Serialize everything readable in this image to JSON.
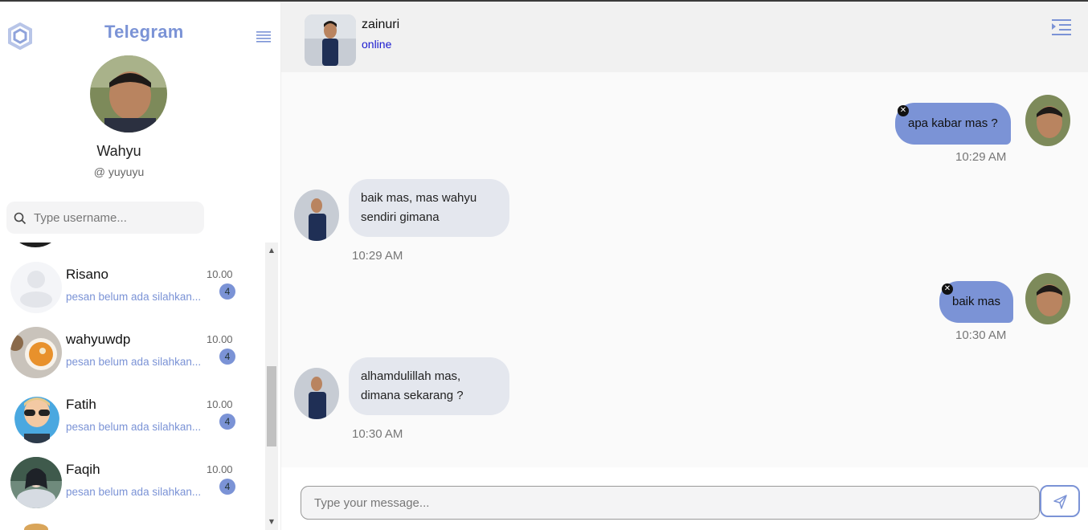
{
  "app": {
    "title": "Telegram"
  },
  "profile": {
    "name": "Wahyu",
    "username": "@ yuyuyu"
  },
  "search": {
    "placeholder": "Type username..."
  },
  "contacts": [
    {
      "name": "Risano",
      "time": "10.00",
      "preview": "pesan belum ada silahkan...",
      "badge": "4",
      "avatar": "placeholder-avatar"
    },
    {
      "name": "wahyuwdp",
      "time": "10.00",
      "preview": "pesan belum ada silahkan...",
      "badge": "4",
      "avatar": "food-bowl-avatar"
    },
    {
      "name": "Fatih",
      "time": "10.00",
      "preview": "pesan belum ada silahkan...",
      "badge": "4",
      "avatar": "cartoon-sunglasses-avatar"
    },
    {
      "name": "Faqih",
      "time": "10.00",
      "preview": "pesan belum ada silahkan...",
      "badge": "4",
      "avatar": "anime-avatar"
    }
  ],
  "chat": {
    "contact_name": "zainuri",
    "contact_status": "online",
    "messages": [
      {
        "direction": "out",
        "text": "apa kabar mas ?",
        "time": "10:29 AM"
      },
      {
        "direction": "in",
        "text": "baik mas, mas wahyu sendiri gimana",
        "time": "10:29 AM"
      },
      {
        "direction": "out",
        "text": "baik mas",
        "time": "10:30 AM"
      },
      {
        "direction": "in",
        "text": "alhamdulillah mas, dimana sekarang ?",
        "time": "10:30 AM"
      }
    ]
  },
  "composer": {
    "placeholder": "Type your message..."
  },
  "colors": {
    "accent": "#7b93d6",
    "status_online": "#1a1ad0",
    "incoming_bubble": "#e4e7ee"
  }
}
